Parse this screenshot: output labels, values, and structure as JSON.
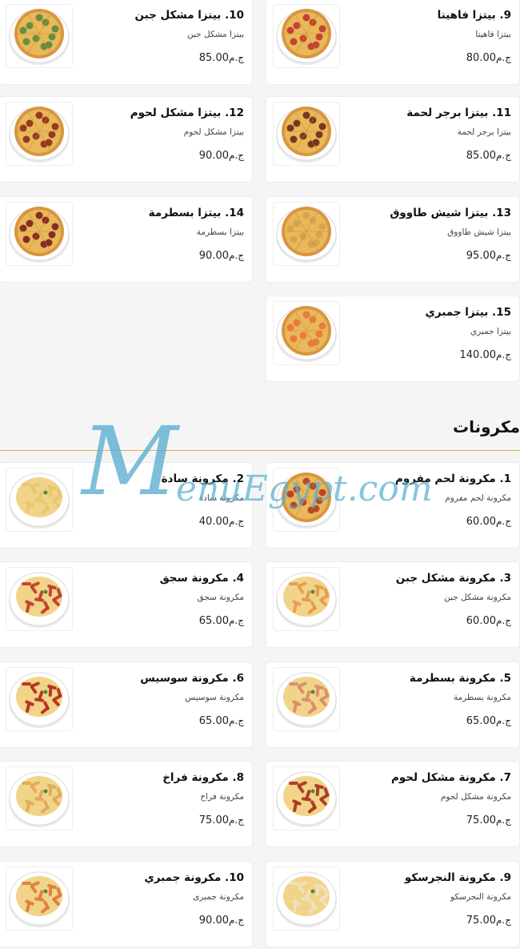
{
  "currency": "ج.م",
  "section_pasta": {
    "title": "مكرونات"
  },
  "watermark": {
    "letter": "M",
    "text": "enuEgypt.com"
  },
  "pizza_items": [
    {
      "name": "10. بيتزا مشكل جبن",
      "desc": "بيتزا مشكل جبن",
      "price": "85.00",
      "image": "pizza-cheese"
    },
    {
      "name": "9. بيتزا فاهيتا",
      "desc": "بيتزا فاهيتا",
      "price": "80.00",
      "image": "pizza-fajita"
    },
    {
      "name": "12. بيتزا مشكل لحوم",
      "desc": "بيتزا مشكل لحوم",
      "price": "90.00",
      "image": "pizza-meat"
    },
    {
      "name": "11. بيتزا برجر لحمة",
      "desc": "بيتزا برجر لحمة",
      "price": "85.00",
      "image": "pizza-burger"
    },
    {
      "name": "14. بيتزا بسطرمة",
      "desc": "بيتزا بسطرمة",
      "price": "90.00",
      "image": "pizza-pastrami"
    },
    {
      "name": "13. بيتزا شيش طاووق",
      "desc": "بيتزا شيش طاووق",
      "price": "95.00",
      "image": "pizza-shish"
    },
    {
      "name": "15. بيتزا جمبري",
      "desc": "بيتزا جمبري",
      "price": "140.00",
      "image": "pizza-shrimp"
    }
  ],
  "pasta_items": [
    {
      "name": "2. مكرونة سادة",
      "desc": "مكرونة سادة",
      "price": "40.00",
      "image": "pasta-plain"
    },
    {
      "name": "1. مكرونة لحم مفروم",
      "desc": "مكرونة لحم مفروم",
      "price": "60.00",
      "image": "pasta-mince"
    },
    {
      "name": "4. مكرونة سجق",
      "desc": "مكرونة سجق",
      "price": "65.00",
      "image": "pasta-sausage"
    },
    {
      "name": "3. مكرونة مشكل جبن",
      "desc": "مكرونة مشكل جبن",
      "price": "60.00",
      "image": "pasta-cheese"
    },
    {
      "name": "6. مكرونة سوسيس",
      "desc": "مكرونة سوسيس",
      "price": "65.00",
      "image": "pasta-hotdog"
    },
    {
      "name": "5. مكرونة بسطرمة",
      "desc": "مكرونة بسطرمة",
      "price": "65.00",
      "image": "pasta-pastrami"
    },
    {
      "name": "8. مكرونة فراخ",
      "desc": "مكرونة فراخ",
      "price": "75.00",
      "image": "pasta-chicken"
    },
    {
      "name": "7. مكرونة مشكل لحوم",
      "desc": "مكرونة مشكل لحوم",
      "price": "75.00",
      "image": "pasta-meat"
    },
    {
      "name": "10. مكرونة جمبري",
      "desc": "مكرونة جمبرى",
      "price": "90.00",
      "image": "pasta-shrimp"
    },
    {
      "name": "9. مكرونة النجرسكو",
      "desc": "مكرونة النجرسكو",
      "price": "75.00",
      "image": "pasta-alfredo"
    }
  ]
}
